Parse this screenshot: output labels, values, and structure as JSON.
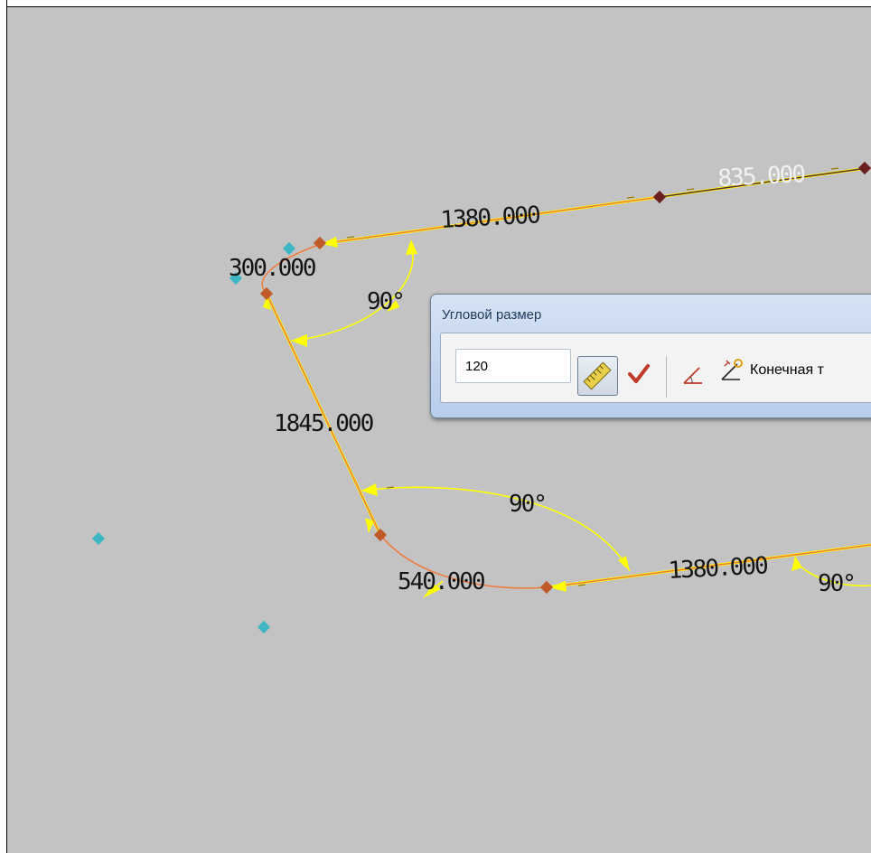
{
  "drawing": {
    "dimensions": {
      "top_length": "1380.000",
      "top_right_length": "835.000",
      "corner_radius_top": "300.000",
      "left_length": "1845.000",
      "corner_radius_bottom": "540.000",
      "bottom_length": "1380.000"
    },
    "angles": {
      "top_left": "90°",
      "bottom_left": "90°",
      "bottom_right": "90°"
    }
  },
  "dialog": {
    "title": "Угловой размер",
    "angle_value": "120",
    "endpoint_label": "Конечная т"
  },
  "icons": {
    "ruler": "ruler-icon",
    "apply": "checkmark-icon",
    "angle": "angle-icon",
    "endpoint": "endpoint-icon"
  },
  "colors": {
    "canvas": "#c3c3c3",
    "dimension_yellow": "#ffff00",
    "path_orange": "#f07a3c",
    "vertex": "#c05a28",
    "marker_cyan": "#3fb6c4",
    "checkmark": "#c0392b"
  }
}
